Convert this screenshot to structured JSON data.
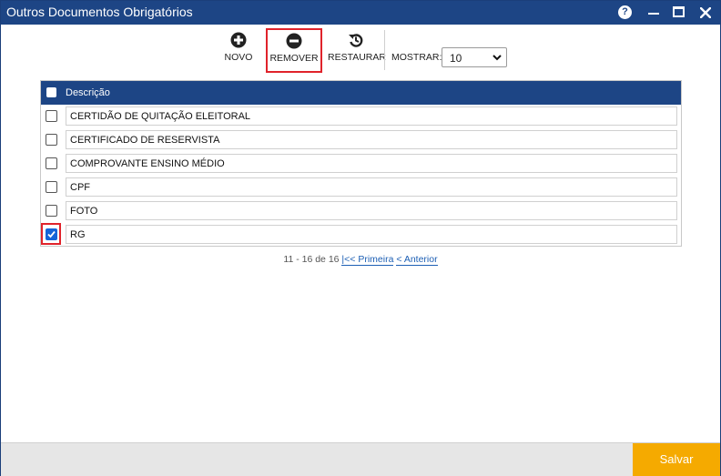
{
  "window": {
    "title": "Outros Documentos Obrigatórios",
    "help_label": "?"
  },
  "toolbar": {
    "novo_label": "NOVO",
    "remover_label": "REMOVER",
    "restaurar_label": "RESTAURAR",
    "mostrar_label": "MOSTRAR:",
    "mostrar_value": "10"
  },
  "grid": {
    "header_label": "Descrição",
    "rows": [
      {
        "label": "CERTIDÃO DE QUITAÇÃO ELEITORAL",
        "checked": false
      },
      {
        "label": "CERTIFICADO DE RESERVISTA",
        "checked": false
      },
      {
        "label": "COMPROVANTE ENSINO MÉDIO",
        "checked": false
      },
      {
        "label": "CPF",
        "checked": false
      },
      {
        "label": "FOTO",
        "checked": false
      },
      {
        "label": "RG",
        "checked": true
      }
    ]
  },
  "pager": {
    "range_text": "11 - 16 de 16",
    "first_label": "|<< Primeira",
    "prev_label": "< Anterior"
  },
  "footer": {
    "save_label": "Salvar"
  },
  "colors": {
    "header_blue": "#1d4585",
    "highlight_red": "#e0232b",
    "save_orange": "#f5aa00",
    "checked_blue": "#1565d8"
  }
}
